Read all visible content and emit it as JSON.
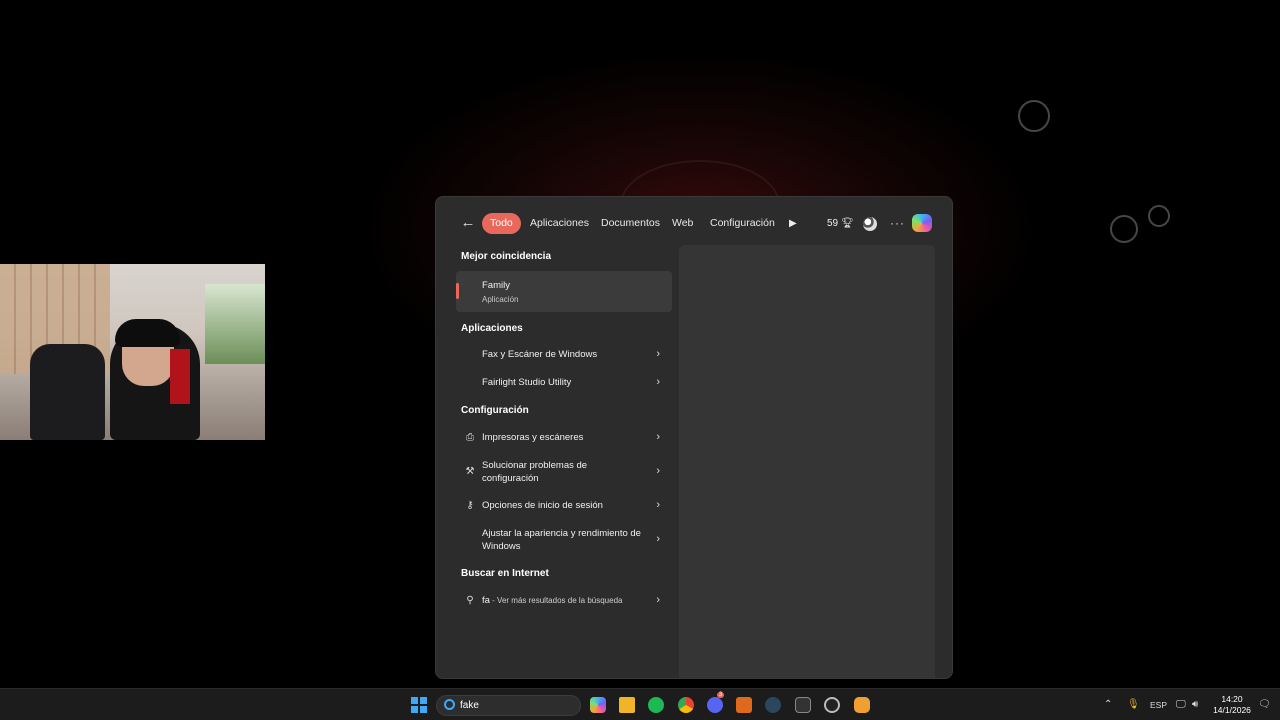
{
  "search_panel": {
    "tabs": [
      "Todo",
      "Aplicaciones",
      "Documentos",
      "Web",
      "Configuración"
    ],
    "points": "59",
    "sections": {
      "best_match": "Mejor coincidencia",
      "apps": "Aplicaciones",
      "settings": "Configuración",
      "web": "Buscar en Internet"
    },
    "best_match": {
      "title": "Family",
      "subtitle": "Aplicación"
    },
    "apps": [
      {
        "label": "Fax y Escáner de Windows"
      },
      {
        "label": "Fairlight Studio Utility"
      }
    ],
    "settings": [
      {
        "label": "Impresoras y escáneres",
        "icon": "printer-icon"
      },
      {
        "label": "Solucionar problemas de configuración",
        "icon": "wrench-icon"
      },
      {
        "label": "Opciones de inicio de sesión",
        "icon": "key-icon"
      },
      {
        "label": "Ajustar la apariencia y rendimiento de Windows",
        "icon": ""
      }
    ],
    "web_search": {
      "query": "fa",
      "suffix": " - Ver más resultados de la búsqueda"
    }
  },
  "taskbar": {
    "search_value": "fake",
    "language": "ESP",
    "time": "14:20",
    "date": "14/1/2026",
    "discord_badge": "3"
  },
  "colors": {
    "accent": "#e8695c",
    "panel": "#2c2c2c"
  }
}
